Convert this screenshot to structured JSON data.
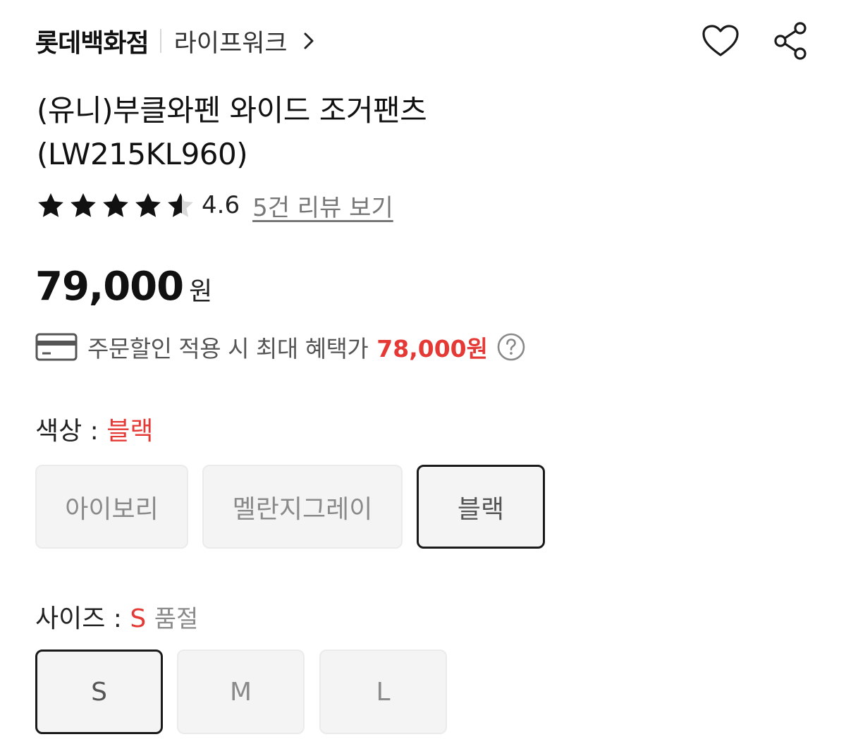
{
  "header": {
    "store_name": "롯데백화점",
    "brand_name": "라이프워크",
    "icons": [
      "chevron-right-icon",
      "heart-icon",
      "share-icon"
    ]
  },
  "product": {
    "title_line1": "(유니)부클와펜 와이드 조거팬츠",
    "title_line2": "(LW215KL960)"
  },
  "rating": {
    "value": 4.6,
    "value_text": "4.6",
    "max": 5,
    "review_link": "5건 리뷰 보기"
  },
  "price": {
    "amount": "79,000",
    "unit": "원"
  },
  "benefit": {
    "text": "주문할인 적용 시 최대 혜택가",
    "amount": "78,000원",
    "icon": "card-icon"
  },
  "color_option": {
    "label": "색상 : ",
    "selected": "블랙",
    "choices": [
      "아이보리",
      "멜란지그레이",
      "블랙"
    ],
    "selected_index": 2
  },
  "size_option": {
    "label": "사이즈 : ",
    "selected": "S",
    "status": "품절",
    "choices": [
      "S",
      "M",
      "L"
    ],
    "selected_index": 0
  },
  "colors": {
    "accent_red": "#e53935",
    "chip_bg": "#f4f4f4",
    "text_primary": "#111111"
  }
}
